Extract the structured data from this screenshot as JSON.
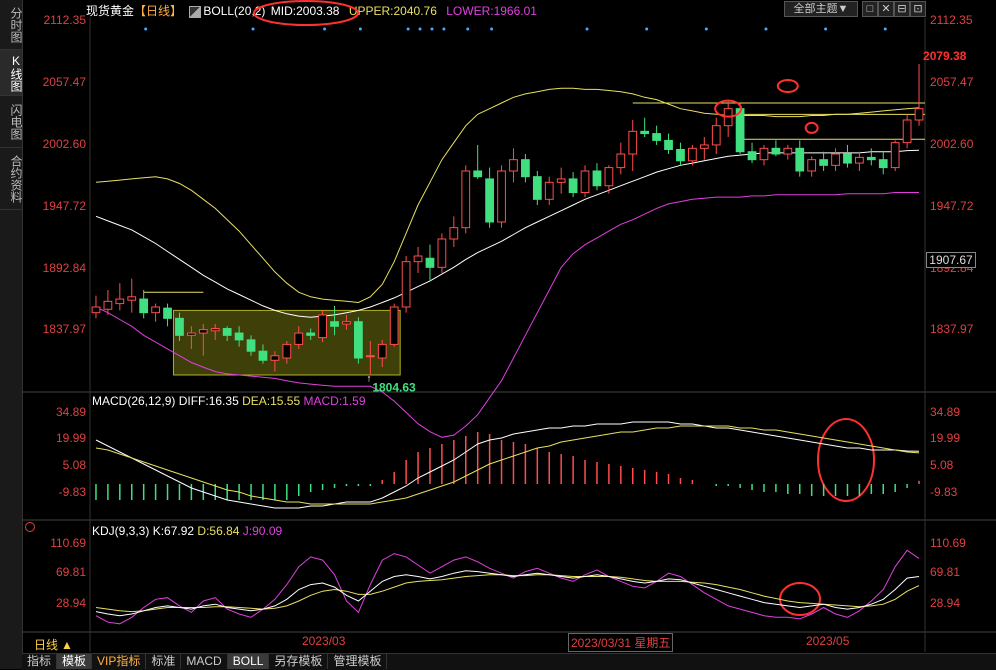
{
  "sidebar": {
    "tabs": [
      {
        "label": "分时图",
        "active": false
      },
      {
        "label": "K线图",
        "active": true
      },
      {
        "label": "闪电图",
        "active": false
      },
      {
        "label": "合约资料",
        "active": false
      }
    ]
  },
  "header": {
    "symbol": "现货黄金",
    "period": "【日线】",
    "boll_label": "BOLL(20,2)",
    "mid": "MID:2003.38",
    "upper": "UPPER:2040.76",
    "lower": "LOWER:1966.01",
    "theme_button": "全部主题▼"
  },
  "window_controls": [
    "□",
    "✕",
    "⊟",
    "⊡",
    "◫"
  ],
  "price_axis": {
    "labels": [
      "2112.35",
      "2057.47",
      "2002.60",
      "1947.72",
      "1892.84",
      "1837.97"
    ],
    "current_price": "1907.67",
    "high_annotation": "2079.38",
    "low_annotation": "1804.63"
  },
  "macd": {
    "title": "MACD(26,12,9)",
    "diff": "DIFF:16.35",
    "dea": "DEA:15.55",
    "macd": "MACD:1.59",
    "axis": [
      "34.89",
      "19.99",
      "5.08",
      "-9.83"
    ]
  },
  "kdj": {
    "title": "KDJ(9,3,3)",
    "k": "K:67.92",
    "d": "D:56.84",
    "j": "J:90.09",
    "axis": [
      "110.69",
      "69.81",
      "28.94"
    ]
  },
  "dates": {
    "period_label": "日线",
    "marks": [
      "2023/03",
      "2023/03/31 星期五",
      "2023/05"
    ]
  },
  "bottom_tabs": [
    "指标",
    "模板",
    "VIP指标",
    "标准",
    "MACD",
    "BOLL",
    "另存模板",
    "管理模板"
  ],
  "bottom_active": "模板",
  "colors": {
    "up": "#ff4d4d",
    "down": "#40e080",
    "mid_line": "#ffffff",
    "upper_line": "#e8e060",
    "lower_line": "#e040e0",
    "accent_red": "#ff3030"
  },
  "chart_data": {
    "type": "candlestick",
    "title": "现货黄金 日线",
    "ylim": [
      1790,
      2120
    ],
    "candles": [
      {
        "o": 1860,
        "h": 1875,
        "l": 1855,
        "c": 1865
      },
      {
        "o": 1863,
        "h": 1880,
        "l": 1858,
        "c": 1870
      },
      {
        "o": 1868,
        "h": 1886,
        "l": 1862,
        "c": 1872
      },
      {
        "o": 1871,
        "h": 1890,
        "l": 1860,
        "c": 1874
      },
      {
        "o": 1872,
        "h": 1880,
        "l": 1855,
        "c": 1860
      },
      {
        "o": 1860,
        "h": 1868,
        "l": 1852,
        "c": 1865
      },
      {
        "o": 1864,
        "h": 1868,
        "l": 1848,
        "c": 1855
      },
      {
        "o": 1855,
        "h": 1860,
        "l": 1835,
        "c": 1840
      },
      {
        "o": 1840,
        "h": 1848,
        "l": 1828,
        "c": 1842
      },
      {
        "o": 1842,
        "h": 1850,
        "l": 1822,
        "c": 1845
      },
      {
        "o": 1844,
        "h": 1850,
        "l": 1836,
        "c": 1846
      },
      {
        "o": 1846,
        "h": 1848,
        "l": 1835,
        "c": 1840
      },
      {
        "o": 1842,
        "h": 1848,
        "l": 1830,
        "c": 1836
      },
      {
        "o": 1836,
        "h": 1840,
        "l": 1822,
        "c": 1826
      },
      {
        "o": 1826,
        "h": 1832,
        "l": 1815,
        "c": 1818
      },
      {
        "o": 1818,
        "h": 1826,
        "l": 1808,
        "c": 1822
      },
      {
        "o": 1820,
        "h": 1835,
        "l": 1815,
        "c": 1832
      },
      {
        "o": 1832,
        "h": 1848,
        "l": 1828,
        "c": 1842
      },
      {
        "o": 1842,
        "h": 1846,
        "l": 1836,
        "c": 1840
      },
      {
        "o": 1838,
        "h": 1862,
        "l": 1834,
        "c": 1858
      },
      {
        "o": 1852,
        "h": 1866,
        "l": 1840,
        "c": 1848
      },
      {
        "o": 1850,
        "h": 1858,
        "l": 1845,
        "c": 1852
      },
      {
        "o": 1852,
        "h": 1856,
        "l": 1815,
        "c": 1820
      },
      {
        "o": 1822,
        "h": 1835,
        "l": 1804.63,
        "c": 1822
      },
      {
        "o": 1820,
        "h": 1836,
        "l": 1812,
        "c": 1832
      },
      {
        "o": 1832,
        "h": 1868,
        "l": 1830,
        "c": 1865
      },
      {
        "o": 1865,
        "h": 1910,
        "l": 1860,
        "c": 1905
      },
      {
        "o": 1905,
        "h": 1918,
        "l": 1895,
        "c": 1910
      },
      {
        "o": 1908,
        "h": 1920,
        "l": 1888,
        "c": 1900
      },
      {
        "o": 1900,
        "h": 1930,
        "l": 1895,
        "c": 1925
      },
      {
        "o": 1925,
        "h": 1945,
        "l": 1918,
        "c": 1935
      },
      {
        "o": 1935,
        "h": 1990,
        "l": 1930,
        "c": 1985
      },
      {
        "o": 1985,
        "h": 2008,
        "l": 1978,
        "c": 1980
      },
      {
        "o": 1978,
        "h": 1988,
        "l": 1935,
        "c": 1940
      },
      {
        "o": 1940,
        "h": 1990,
        "l": 1935,
        "c": 1985
      },
      {
        "o": 1985,
        "h": 2005,
        "l": 1975,
        "c": 1995
      },
      {
        "o": 1995,
        "h": 2000,
        "l": 1975,
        "c": 1980
      },
      {
        "o": 1980,
        "h": 1985,
        "l": 1955,
        "c": 1960
      },
      {
        "o": 1960,
        "h": 1980,
        "l": 1955,
        "c": 1975
      },
      {
        "o": 1975,
        "h": 1988,
        "l": 1965,
        "c": 1978
      },
      {
        "o": 1978,
        "h": 1984,
        "l": 1962,
        "c": 1966
      },
      {
        "o": 1966,
        "h": 1990,
        "l": 1962,
        "c": 1985
      },
      {
        "o": 1985,
        "h": 1992,
        "l": 1968,
        "c": 1972
      },
      {
        "o": 1972,
        "h": 1990,
        "l": 1965,
        "c": 1988
      },
      {
        "o": 1988,
        "h": 2010,
        "l": 1982,
        "c": 2000
      },
      {
        "o": 2000,
        "h": 2030,
        "l": 1985,
        "c": 2020
      },
      {
        "o": 2020,
        "h": 2032,
        "l": 2015,
        "c": 2018
      },
      {
        "o": 2018,
        "h": 2025,
        "l": 2008,
        "c": 2012
      },
      {
        "o": 2012,
        "h": 2018,
        "l": 2000,
        "c": 2004
      },
      {
        "o": 2004,
        "h": 2010,
        "l": 1990,
        "c": 1994
      },
      {
        "o": 1994,
        "h": 2008,
        "l": 1990,
        "c": 2005
      },
      {
        "o": 2005,
        "h": 2015,
        "l": 1995,
        "c": 2008
      },
      {
        "o": 2008,
        "h": 2032,
        "l": 2000,
        "c": 2025
      },
      {
        "o": 2025,
        "h": 2048,
        "l": 2015,
        "c": 2040
      },
      {
        "o": 2040,
        "h": 2045,
        "l": 2000,
        "c": 2002
      },
      {
        "o": 2002,
        "h": 2010,
        "l": 1992,
        "c": 1995
      },
      {
        "o": 1995,
        "h": 2008,
        "l": 1990,
        "c": 2005
      },
      {
        "o": 2005,
        "h": 2012,
        "l": 1998,
        "c": 2000
      },
      {
        "o": 2000,
        "h": 2008,
        "l": 1995,
        "c": 2005
      },
      {
        "o": 2005,
        "h": 2012,
        "l": 1980,
        "c": 1985
      },
      {
        "o": 1985,
        "h": 1998,
        "l": 1980,
        "c": 1995
      },
      {
        "o": 1995,
        "h": 2002,
        "l": 1985,
        "c": 1990
      },
      {
        "o": 1990,
        "h": 2005,
        "l": 1985,
        "c": 2000
      },
      {
        "o": 2000,
        "h": 2008,
        "l": 1988,
        "c": 1992
      },
      {
        "o": 1992,
        "h": 2002,
        "l": 1985,
        "c": 1997
      },
      {
        "o": 1997,
        "h": 2005,
        "l": 1990,
        "c": 1995
      },
      {
        "o": 1995,
        "h": 2002,
        "l": 1982,
        "c": 1988
      },
      {
        "o": 1988,
        "h": 2012,
        "l": 1985,
        "c": 2010
      },
      {
        "o": 2010,
        "h": 2035,
        "l": 2005,
        "c": 2030
      },
      {
        "o": 2030,
        "h": 2079.38,
        "l": 2025,
        "c": 2040
      }
    ],
    "boll": {
      "mid": [
        1945,
        1941,
        1937,
        1933,
        1927,
        1921,
        1914,
        1907,
        1900,
        1893,
        1887,
        1881,
        1876,
        1871,
        1866,
        1862,
        1859,
        1857,
        1856,
        1857,
        1858,
        1860,
        1862,
        1865,
        1869,
        1873,
        1878,
        1883,
        1888,
        1894,
        1900,
        1907,
        1913,
        1918,
        1923,
        1929,
        1935,
        1940,
        1945,
        1950,
        1955,
        1960,
        1964,
        1968,
        1972,
        1976,
        1980,
        1984,
        1987,
        1990,
        1992,
        1994,
        1996,
        1998,
        1999,
        2000,
        2001,
        2001,
        2001,
        2001,
        2001,
        2001,
        2001,
        2001,
        2001,
        2002,
        2002,
        2002,
        2003,
        2003.38
      ],
      "upper": [
        1975,
        1976,
        1977,
        1978,
        1979,
        1980,
        1978,
        1974,
        1968,
        1960,
        1952,
        1942,
        1932,
        1920,
        1908,
        1896,
        1886,
        1878,
        1874,
        1872,
        1871,
        1870,
        1869,
        1874,
        1885,
        1905,
        1930,
        1955,
        1975,
        1995,
        2010,
        2025,
        2035,
        2040,
        2045,
        2050,
        2053,
        2055,
        2057,
        2058,
        2058,
        2057,
        2057,
        2056,
        2055,
        2053,
        2050,
        2048,
        2044,
        2040,
        2038,
        2036,
        2035,
        2034,
        2034,
        2034,
        2034,
        2033,
        2033,
        2033,
        2034,
        2034,
        2035,
        2035,
        2036,
        2037,
        2038,
        2039,
        2040,
        2040.76
      ],
      "lower": [
        1865,
        1860,
        1854,
        1848,
        1840,
        1834,
        1828,
        1822,
        1816,
        1812,
        1808,
        1806,
        1805,
        1804,
        1803,
        1802,
        1800,
        1798,
        1797,
        1796,
        1795,
        1795,
        1795,
        1795,
        1790,
        1782,
        1772,
        1762,
        1755,
        1750,
        1752,
        1760,
        1770,
        1785,
        1800,
        1820,
        1840,
        1860,
        1880,
        1900,
        1912,
        1920,
        1926,
        1932,
        1938,
        1942,
        1947,
        1952,
        1956,
        1958,
        1960,
        1961,
        1962,
        1962,
        1962,
        1963,
        1963,
        1964,
        1964,
        1964,
        1964,
        1964,
        1964,
        1965,
        1965,
        1965,
        1965,
        1966,
        1966,
        1966.01
      ]
    },
    "macd": {
      "ylim": [
        -18,
        40
      ],
      "diff": [
        22,
        19,
        16,
        13,
        10,
        7,
        4,
        1,
        -2,
        -4,
        -6,
        -8,
        -9,
        -10,
        -11,
        -12,
        -12,
        -12,
        -11,
        -11,
        -10,
        -9,
        -9,
        -9,
        -7,
        -4,
        -1,
        3,
        6,
        9,
        12,
        16,
        20,
        22,
        23,
        25,
        26,
        27,
        28,
        28,
        29,
        29,
        30,
        30,
        30,
        31,
        31,
        31,
        31,
        30,
        30,
        29,
        28,
        28,
        27,
        26,
        25,
        24,
        23,
        22,
        21,
        20,
        19,
        18,
        18,
        17,
        17,
        17,
        16.5,
        16.35
      ],
      "dea": [
        18,
        17,
        15,
        13,
        11,
        9,
        7,
        5,
        3,
        1,
        -1,
        -3,
        -4,
        -6,
        -7,
        -8,
        -9,
        -9,
        -10,
        -10,
        -10,
        -10,
        -10,
        -10,
        -9,
        -8,
        -7,
        -5,
        -3,
        -1,
        1,
        4,
        7,
        10,
        12,
        14,
        16,
        18,
        19,
        21,
        22,
        23,
        24,
        25,
        26,
        26,
        27,
        28,
        28,
        29,
        29,
        29,
        29,
        29,
        28,
        28,
        27,
        27,
        26,
        25,
        24,
        23,
        22,
        21,
        20,
        19,
        18,
        17,
        16,
        15.55
      ],
      "hist": [
        -8,
        -8,
        -8,
        -8,
        -8,
        -8,
        -8,
        -8,
        -8,
        -8,
        -8,
        -8,
        -8,
        -8,
        -8,
        -8,
        -8,
        -6,
        -4,
        -3,
        -2,
        -1,
        -1,
        -1,
        2,
        6,
        12,
        16,
        18,
        20,
        22,
        24,
        26,
        25,
        22,
        21,
        20,
        18,
        16,
        15,
        14,
        12,
        11,
        10,
        9,
        8,
        7,
        6,
        5,
        3,
        2,
        0,
        -1,
        -1,
        -2,
        -3,
        -4,
        -4,
        -5,
        -5,
        -6,
        -6,
        -6,
        -6,
        -6,
        -5,
        -5,
        -4,
        -2,
        1.59
      ]
    },
    "kdj": {
      "ylim": [
        0,
        120
      ],
      "k": [
        25,
        22,
        20,
        22,
        26,
        30,
        32,
        30,
        28,
        32,
        34,
        30,
        28,
        26,
        28,
        32,
        40,
        52,
        58,
        60,
        55,
        45,
        38,
        50,
        62,
        68,
        70,
        68,
        65,
        68,
        72,
        75,
        74,
        72,
        70,
        68,
        70,
        72,
        70,
        68,
        66,
        68,
        70,
        68,
        65,
        62,
        60,
        62,
        65,
        64,
        60,
        56,
        52,
        48,
        44,
        40,
        36,
        34,
        32,
        30,
        32,
        34,
        30,
        28,
        30,
        34,
        40,
        52,
        66,
        67.92
      ],
      "d": [
        30,
        28,
        26,
        25,
        26,
        28,
        30,
        30,
        30,
        30,
        31,
        31,
        30,
        29,
        28,
        29,
        32,
        38,
        45,
        50,
        52,
        50,
        46,
        46,
        50,
        55,
        60,
        62,
        63,
        64,
        66,
        68,
        69,
        70,
        70,
        69,
        69,
        70,
        70,
        69,
        68,
        68,
        68,
        68,
        67,
        65,
        63,
        62,
        62,
        62,
        61,
        60,
        58,
        55,
        52,
        48,
        44,
        41,
        38,
        36,
        35,
        34,
        33,
        32,
        31,
        32,
        34,
        40,
        50,
        56.84
      ],
      "j": [
        20,
        12,
        10,
        18,
        30,
        40,
        42,
        32,
        24,
        38,
        42,
        28,
        22,
        18,
        28,
        40,
        58,
        80,
        92,
        88,
        70,
        38,
        24,
        58,
        88,
        96,
        92,
        82,
        72,
        80,
        88,
        92,
        86,
        78,
        72,
        66,
        74,
        78,
        72,
        66,
        62,
        70,
        76,
        68,
        62,
        56,
        54,
        62,
        72,
        68,
        58,
        48,
        40,
        32,
        28,
        24,
        20,
        18,
        18,
        16,
        22,
        30,
        22,
        18,
        26,
        38,
        52,
        80,
        100,
        90.09
      ]
    }
  }
}
